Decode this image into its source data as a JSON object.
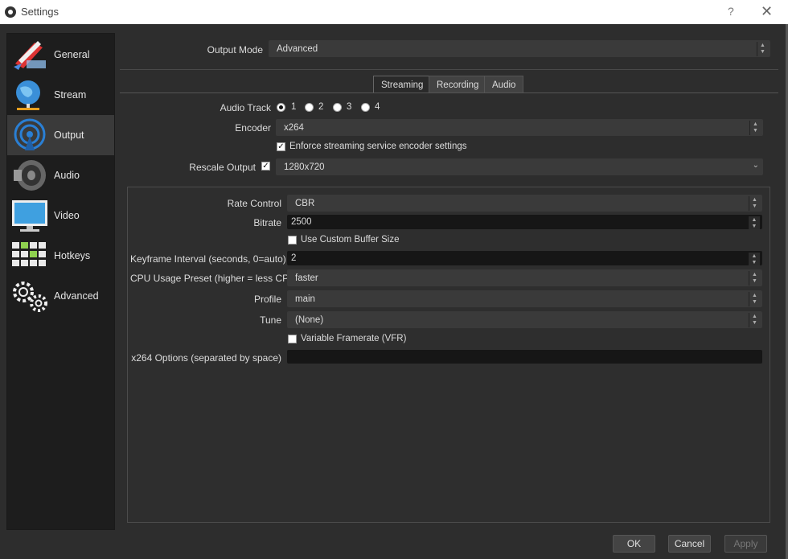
{
  "window": {
    "title": "Settings",
    "help": "?",
    "close": "✕"
  },
  "sidebar": {
    "items": [
      {
        "label": "General",
        "icon": "general-icon"
      },
      {
        "label": "Stream",
        "icon": "stream-globe-icon"
      },
      {
        "label": "Output",
        "icon": "output-antenna-icon",
        "active": true
      },
      {
        "label": "Audio",
        "icon": "speaker-icon"
      },
      {
        "label": "Video",
        "icon": "monitor-icon"
      },
      {
        "label": "Hotkeys",
        "icon": "keyboard-icon"
      },
      {
        "label": "Advanced",
        "icon": "gears-icon"
      }
    ]
  },
  "output_mode": {
    "label": "Output Mode",
    "value": "Advanced"
  },
  "tabs": [
    {
      "label": "Streaming",
      "active": true
    },
    {
      "label": "Recording"
    },
    {
      "label": "Audio"
    }
  ],
  "streaming": {
    "audio_track": {
      "label": "Audio Track",
      "options": [
        "1",
        "2",
        "3",
        "4"
      ],
      "selected": "1"
    },
    "encoder": {
      "label": "Encoder",
      "value": "x264"
    },
    "enforce": {
      "label": "Enforce streaming service encoder settings",
      "checked": true
    },
    "rescale": {
      "label": "Rescale Output",
      "checked": true,
      "value": "1280x720"
    }
  },
  "encoder_settings": {
    "rate_control": {
      "label": "Rate Control",
      "value": "CBR"
    },
    "bitrate": {
      "label": "Bitrate",
      "value": "2500"
    },
    "custom_buffer": {
      "label": "Use Custom Buffer Size",
      "checked": false
    },
    "keyframe": {
      "label": "Keyframe Interval (seconds, 0=auto)",
      "value": "2"
    },
    "cpu_preset": {
      "label": "CPU Usage Preset (higher = less CPU)",
      "value": "faster"
    },
    "profile": {
      "label": "Profile",
      "value": "main"
    },
    "tune": {
      "label": "Tune",
      "value": "(None)"
    },
    "vfr": {
      "label": "Variable Framerate (VFR)",
      "checked": false
    },
    "x264_options": {
      "label": "x264 Options (separated by space)",
      "value": ""
    }
  },
  "buttons": {
    "ok": "OK",
    "cancel": "Cancel",
    "apply": "Apply"
  },
  "colors": {
    "window_bg": "#2d2d2d",
    "sidebar_bg": "#1d1d1d",
    "field_bg": "#3a3a3a",
    "dark_field_bg": "#161616",
    "accent_blue": "#2a7fd4"
  }
}
